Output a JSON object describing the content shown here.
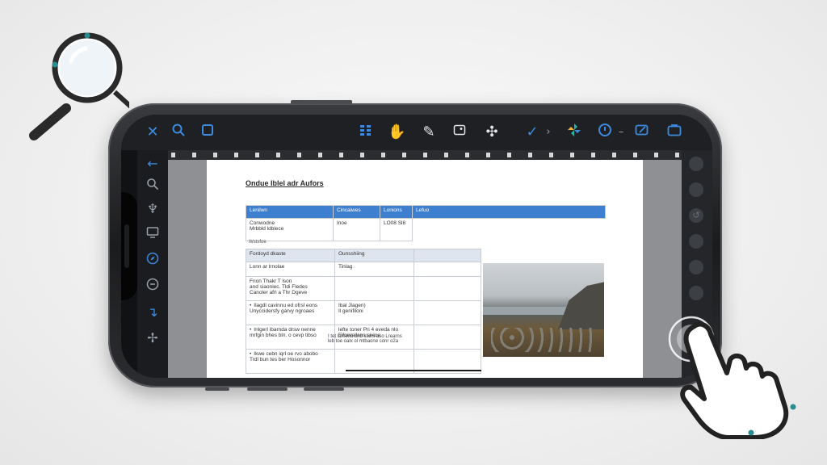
{
  "toolbar": {
    "left_icons": [
      "close-icon",
      "search-icon",
      "square-icon"
    ],
    "center_icons": [
      "grid-icon",
      "hand-highlight-icon",
      "pen-icon",
      "image-icon",
      "crosshair-icon"
    ],
    "right_icons": [
      "check-icon",
      "pinwheel-icon",
      "timer-icon",
      "edit-box-icon",
      "folder-icon"
    ]
  },
  "sidebar": {
    "icons": [
      "back-arrow-icon",
      "search-icon",
      "trophy-icon",
      "monitor-icon",
      "compass-icon",
      "circle-icon",
      "arrow-down-icon",
      "sparkle-icon"
    ]
  },
  "document": {
    "title": "Ondue Iblel adr Aufors",
    "table1": {
      "headers": [
        "Lenilwn",
        "Cincaiwes",
        "Lonions",
        "Lefuo"
      ],
      "rows": [
        [
          "Conwodne\nMrbbld ldblece",
          "Inoe",
          "LO08 Sl8",
          ""
        ]
      ],
      "note": "Wstsfoe"
    },
    "table2": {
      "headers": [
        "Fordoyd dkaste",
        "Ounsshiing",
        ""
      ],
      "rows": [
        [
          "Lonn ar lrnolae",
          "Tinlag",
          ""
        ],
        [
          "Fnon Thakr T lson\nand siaoniec. Tldi Fledes\nCanoler afrl a Thr Dgeve",
          "",
          ""
        ]
      ],
      "bullets": [
        [
          "Ilagdl cavinnu ed ofrsl eons\nUnyccidersfy garvy ngroaes",
          "Ibal Jlagen)\nIl genifiloni",
          ""
        ],
        [
          "Inlgerl ibarnda drsw nenne\nmrfgin bhes bln. o cevp tibso",
          "lefte toner Pri 4 eveda nlo\nFifonrellens sivioe",
          ""
        ],
        [
          "Ikwe cebn iqrl oe rvo abobo\nTrdl bun tes ber Hosonnor",
          "",
          ""
        ]
      ],
      "side_text": "I tet lamens dnd sluns aso Lrearns\nleb toe oalx ol mtbaone conr o2a"
    },
    "photo_alt": "coastal cliff landscape"
  },
  "colors": {
    "accent": "#3d8be0",
    "table_header": "#3f7fd0",
    "toolbar_bg": "#1e2024",
    "page_bg": "#ffffff"
  },
  "overlays": {
    "magnifier": "magnifier-icon",
    "hand": "hand-pointer-icon"
  }
}
